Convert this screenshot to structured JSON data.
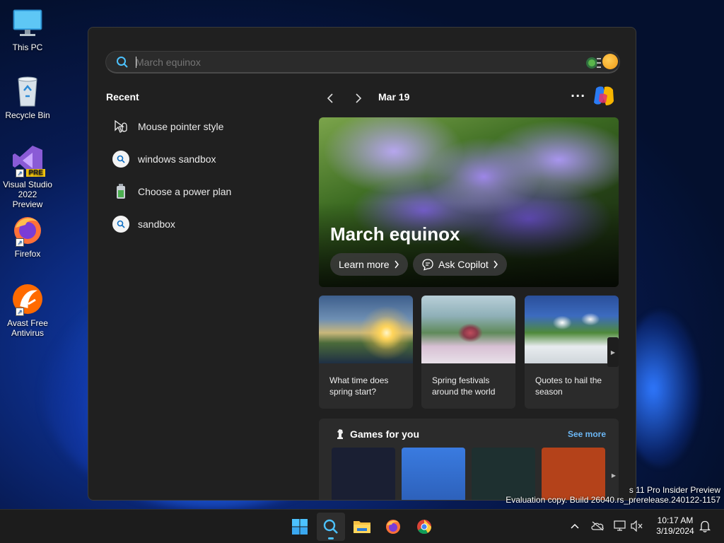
{
  "desktop": {
    "icons": [
      {
        "label": "This PC"
      },
      {
        "label": "Recycle Bin"
      },
      {
        "label": "Visual Studio 2022 Preview",
        "badge": "PRE"
      },
      {
        "label": "Firefox"
      },
      {
        "label": "Avast Free Antivirus"
      }
    ]
  },
  "search": {
    "value": "March equinox",
    "placeholder": "March equinox"
  },
  "recent": {
    "title": "Recent",
    "items": [
      {
        "label": "Mouse pointer style",
        "icon": "mouse-pointer-icon"
      },
      {
        "label": "windows sandbox",
        "icon": "search-icon"
      },
      {
        "label": "Choose a power plan",
        "icon": "battery-icon"
      },
      {
        "label": "sandbox",
        "icon": "search-icon"
      }
    ]
  },
  "highlights": {
    "date": "Mar 19",
    "more": "···",
    "hero": {
      "title": "March equinox",
      "learn_more": "Learn more",
      "ask_copilot": "Ask Copilot"
    },
    "cards": [
      {
        "caption": "What time does spring start?"
      },
      {
        "caption": "Spring festivals around the world"
      },
      {
        "caption": "Quotes to hail the season"
      }
    ]
  },
  "games": {
    "title": "Games for you",
    "see_more": "See more"
  },
  "watermark": {
    "line1": "s 11 Pro Insider Preview",
    "line2": "Evaluation copy. Build 26040.rs_prerelease.240122-1157"
  },
  "clock": {
    "time": "10:17 AM",
    "date": "3/19/2024"
  },
  "colors": {
    "accent": "#4cc2ff",
    "link": "#6cb8f6",
    "flyout_bg": "#202020",
    "taskbar_bg": "#1c1c1c"
  }
}
